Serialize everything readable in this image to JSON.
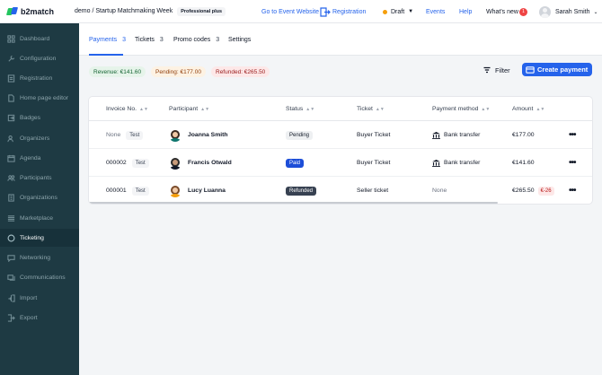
{
  "app": {
    "logo_text": "b2match",
    "breadcrumb": "demo / Startup Matchmaking Week",
    "plan_badge": "Professional plus"
  },
  "topnav": {
    "event_website": "Go to Event Website",
    "registration": "Registration",
    "draft": "Draft",
    "events": "Events",
    "help": "Help",
    "whats_new": "What's new",
    "whats_new_count": "1",
    "user_name": "Sarah Smith"
  },
  "sidebar": {
    "items": [
      {
        "label": "Dashboard",
        "icon": "dashboard-icon"
      },
      {
        "label": "Configuration",
        "icon": "wrench-icon"
      },
      {
        "label": "Registration",
        "icon": "registration-icon"
      },
      {
        "label": "Home page editor",
        "icon": "doc-icon"
      },
      {
        "label": "Badges",
        "icon": "badge-icon"
      },
      {
        "label": "Organizers",
        "icon": "users-icon"
      },
      {
        "label": "Agenda",
        "icon": "calendar-icon"
      },
      {
        "label": "Participants",
        "icon": "participants-icon"
      },
      {
        "label": "Organizations",
        "icon": "building-icon"
      },
      {
        "label": "Marketplace",
        "icon": "list-icon"
      },
      {
        "label": "Ticketing",
        "icon": "ticket-icon",
        "active": true
      },
      {
        "label": "Networking",
        "icon": "chat-icon"
      },
      {
        "label": "Communications",
        "icon": "mail-icon"
      },
      {
        "label": "Import",
        "icon": "import-icon"
      },
      {
        "label": "Export",
        "icon": "export-icon"
      }
    ]
  },
  "tabs": [
    {
      "label": "Payments",
      "count": "3",
      "active": true
    },
    {
      "label": "Tickets",
      "count": "3"
    },
    {
      "label": "Promo codes",
      "count": "3"
    },
    {
      "label": "Settings",
      "count": ""
    }
  ],
  "summary": {
    "revenue": "Revenue: €141.60",
    "pending": "Pending: €177.00",
    "refunded": "Refunded: €265.50"
  },
  "actions": {
    "filter": "Filter",
    "create_payment": "Create payment"
  },
  "table": {
    "columns": [
      "Invoice No.",
      "Participant",
      "Status",
      "Ticket",
      "Payment method",
      "Amount"
    ],
    "rows": [
      {
        "invoice": "None",
        "tag": "Test",
        "participant": "Joanna Smith",
        "status": "Pending",
        "ticket": "Buyer Ticket",
        "method": "Bank transfer",
        "amount": "€177.00",
        "amount_tag": ""
      },
      {
        "invoice": "000002",
        "tag": "Test",
        "participant": "Francis Otwald",
        "status": "Paid",
        "ticket": "Buyer Ticket",
        "method": "Bank transfer",
        "amount": "€141.60",
        "amount_tag": ""
      },
      {
        "invoice": "000001",
        "tag": "Test",
        "participant": "Lucy Luanna",
        "status": "Refunded",
        "ticket": "Seller ticket",
        "method": "None",
        "amount": "€265.50",
        "amount_tag": "€-26"
      }
    ],
    "row_menu": "•••"
  },
  "colors": {
    "accent": "#2563eb",
    "sidebar": "#1e3a43",
    "paid": "#1d4ed8",
    "refunded": "#374151"
  }
}
